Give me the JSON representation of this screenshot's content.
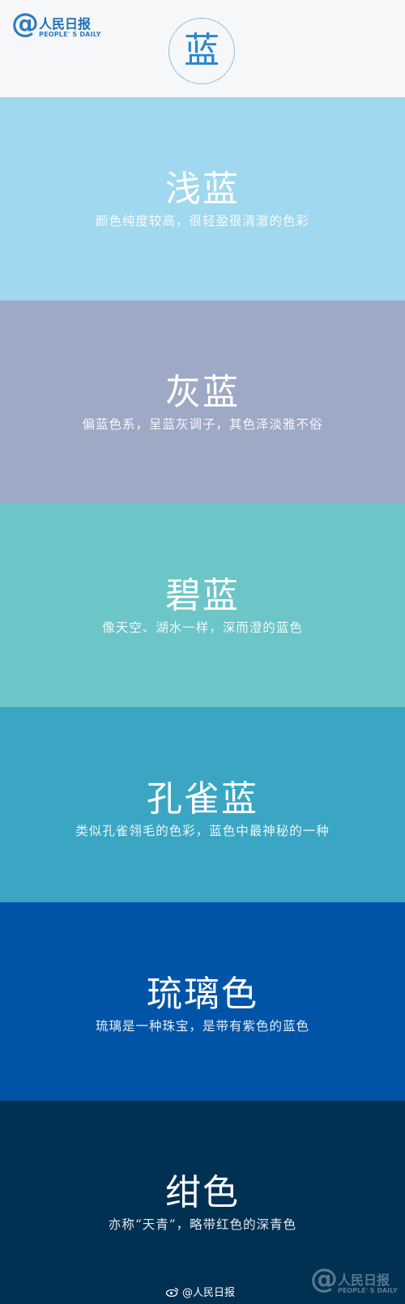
{
  "header": {
    "logo": {
      "symbol": "@",
      "name": "人民日报",
      "sub": "PEOPLE' S DAILY"
    },
    "badge_char": "蓝",
    "accent_color": "#2b86c8"
  },
  "blocks": [
    {
      "title": "浅蓝",
      "desc": "颜色纯度较高，很轻盈很清澈的色彩",
      "color": "#a0d8ef"
    },
    {
      "title": "灰蓝",
      "desc": "偏蓝色系，呈蓝灰调子，其色泽淡雅不俗",
      "color": "#9ea9c6"
    },
    {
      "title": "碧蓝",
      "desc": "像天空、湖水一样，深而澄的蓝色",
      "color": "#6cc5c7"
    },
    {
      "title": "孔雀蓝",
      "desc": "类似孔雀翎毛的色彩，蓝色中最神秘的一种",
      "color": "#3aa6c4"
    },
    {
      "title": "琉璃色",
      "desc": "琉璃是一种珠宝，是带有紫色的蓝色",
      "color": "#0054a7"
    },
    {
      "title": "绀色",
      "desc": "亦称“天青”，略带红色的深青色",
      "color": "#003052"
    }
  ],
  "footer": {
    "weibo_icon": "weibo-icon",
    "weibo_handle": "@人民日报",
    "watermark": {
      "symbol": "@",
      "name": "人民日报",
      "sub": "PEOPLE' S DAILY"
    }
  }
}
